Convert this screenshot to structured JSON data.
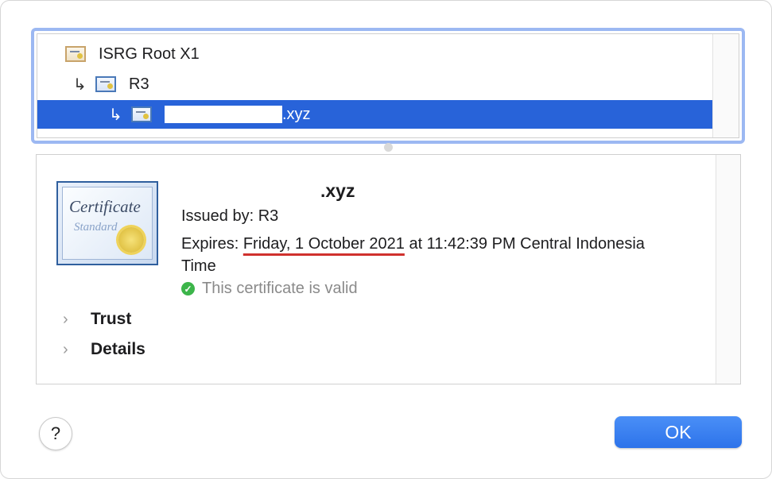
{
  "tree": {
    "items": [
      {
        "label": "ISRG Root X1",
        "icon": "certificate-icon"
      },
      {
        "label": "R3",
        "icon": "certificate-icon",
        "arrow": "↳"
      },
      {
        "label": ".xyz",
        "icon": "certificate-icon",
        "arrow": "↳",
        "selected": true
      }
    ]
  },
  "certificate": {
    "image_title": "Certificate",
    "image_subtitle": "Standard",
    "name": ".xyz",
    "issued_by": "Issued by: R3",
    "expires_prefix": "Expires: ",
    "expires_date": "Friday, 1 October 2021",
    "expires_rest": " at 11:42:39 PM Central Indonesia Time",
    "valid_text": "This certificate is valid"
  },
  "sections": {
    "trust": "Trust",
    "details": "Details"
  },
  "footer": {
    "help": "?",
    "ok": "OK"
  },
  "colors": {
    "selection": "#2863d9",
    "ok_button": "#2d73ea",
    "valid_check": "#3cb54a",
    "annotation_underline": "#d0312d"
  }
}
